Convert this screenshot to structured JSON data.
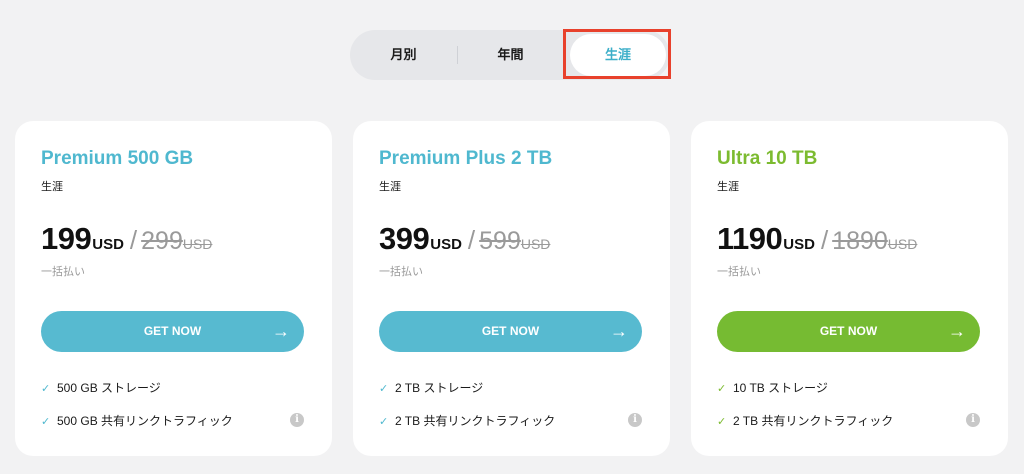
{
  "billing_toggle": {
    "options": [
      "月別",
      "年間",
      "生涯"
    ],
    "selected": "生涯"
  },
  "colors": {
    "teal": "#57bad0",
    "green": "#76bb32",
    "highlight": "#e8412c"
  },
  "plans": [
    {
      "title": "Premium 500 GB",
      "period": "生涯",
      "price": "199",
      "currency": "USD",
      "old_price": "299",
      "old_currency": "USD",
      "payment_note": "一括払い",
      "cta": "GET NOW",
      "features": [
        "500 GB ストレージ",
        "500 GB 共有リンクトラフィック"
      ],
      "accent": "teal"
    },
    {
      "title": "Premium Plus 2 TB",
      "period": "生涯",
      "price": "399",
      "currency": "USD",
      "old_price": "599",
      "old_currency": "USD",
      "payment_note": "一括払い",
      "cta": "GET NOW",
      "features": [
        "2 TB ストレージ",
        "2 TB 共有リンクトラフィック"
      ],
      "accent": "teal"
    },
    {
      "title": "Ultra 10 TB",
      "period": "生涯",
      "price": "1190",
      "currency": "USD",
      "old_price": "1890",
      "old_currency": "USD",
      "payment_note": "一括払い",
      "cta": "GET NOW",
      "features": [
        "10 TB ストレージ",
        "2 TB 共有リンクトラフィック"
      ],
      "accent": "green"
    }
  ],
  "icons": {
    "check": "check-icon",
    "arrow": "arrow-right-icon",
    "info": "info-icon"
  }
}
